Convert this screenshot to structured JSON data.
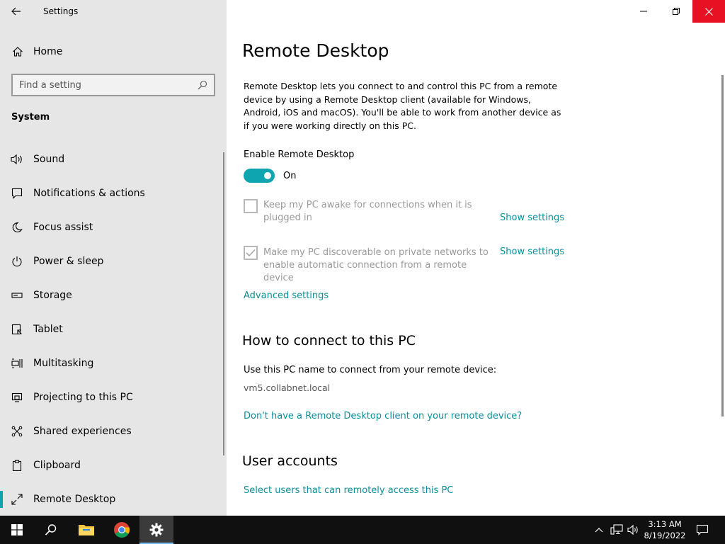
{
  "window": {
    "title": "Settings"
  },
  "sidebar": {
    "home_label": "Home",
    "search_placeholder": "Find a setting",
    "section_title": "System",
    "items": [
      {
        "label": "Sound",
        "icon": "speaker-icon"
      },
      {
        "label": "Notifications & actions",
        "icon": "notification-icon"
      },
      {
        "label": "Focus assist",
        "icon": "moon-icon"
      },
      {
        "label": "Power & sleep",
        "icon": "power-icon"
      },
      {
        "label": "Storage",
        "icon": "storage-icon"
      },
      {
        "label": "Tablet",
        "icon": "tablet-icon"
      },
      {
        "label": "Multitasking",
        "icon": "multitasking-icon"
      },
      {
        "label": "Projecting to this PC",
        "icon": "projecting-icon"
      },
      {
        "label": "Shared experiences",
        "icon": "shared-experiences-icon"
      },
      {
        "label": "Clipboard",
        "icon": "clipboard-icon"
      },
      {
        "label": "Remote Desktop",
        "icon": "remote-desktop-icon",
        "selected": true
      }
    ]
  },
  "main": {
    "title": "Remote Desktop",
    "description": "Remote Desktop lets you connect to and control this PC from a remote device by using a Remote Desktop client (available for Windows, Android, iOS and macOS). You'll be able to work from another device as if you were working directly on this PC.",
    "enable_label": "Enable Remote Desktop",
    "toggle_state": "On",
    "option_awake": {
      "text": "Keep my PC awake for connections when it is plugged in",
      "checked": false,
      "link": "Show settings"
    },
    "option_discoverable": {
      "text": "Make my PC discoverable on private networks to enable automatic connection from a remote device",
      "checked": true,
      "link": "Show settings"
    },
    "advanced_link": "Advanced settings",
    "connect_heading": "How to connect to this PC",
    "connect_text": "Use this PC name to connect from your remote device:",
    "pc_name": "vm5.collabnet.local",
    "client_link": "Don't have a Remote Desktop client on your remote device?",
    "user_accounts_heading": "User accounts",
    "users_link": "Select users that can remotely access this PC"
  },
  "taskbar": {
    "time": "3:13 AM",
    "date": "8/19/2022"
  },
  "colors": {
    "accent": "#0ea5b0",
    "link": "#0a8f9c",
    "close_button": "#e81123",
    "sidebar_bg": "#e6e6e6",
    "taskbar_bg": "#101010"
  }
}
